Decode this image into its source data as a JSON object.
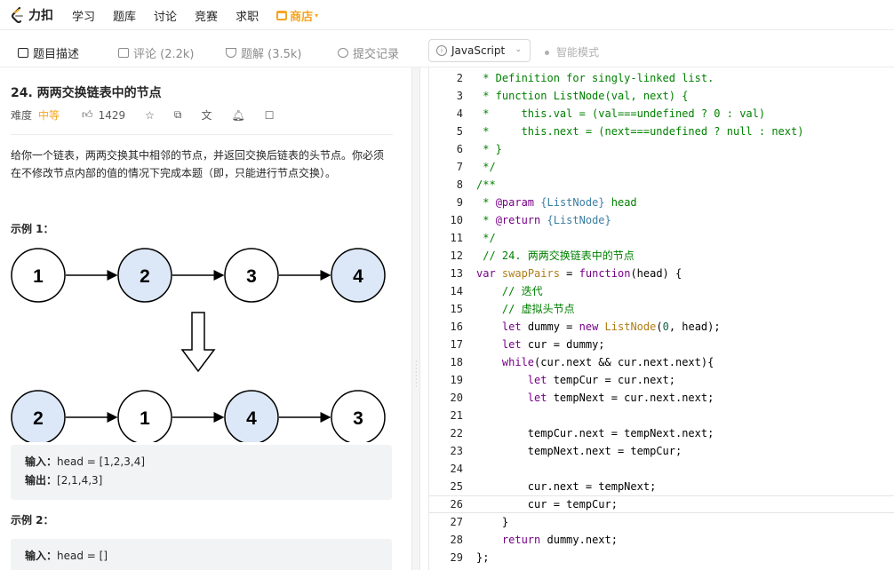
{
  "nav": {
    "logo_text": "力扣",
    "links": [
      "学习",
      "题库",
      "讨论",
      "竞赛",
      "求职"
    ],
    "shop_label": "商店"
  },
  "tabs": {
    "description": "题目描述",
    "comments": "评论 (2.2k)",
    "solutions": "题解 (3.5k)",
    "submissions": "提交记录"
  },
  "editor_toolbar": {
    "language": "JavaScript",
    "smart_mode": "智能模式"
  },
  "problem": {
    "title": "24. 两两交换链表中的节点",
    "difficulty_label": "难度",
    "difficulty": "中等",
    "likes": "1429",
    "description": "给你一个链表，两两交换其中相邻的节点，并返回交换后链表的头节点。你必须在不修改节点内部的值的情况下完成本题（即，只能进行节点交换）。",
    "example1_title": "示例 1：",
    "example1_input_label": "输入：",
    "example1_input": "head = [1,2,3,4]",
    "example1_output_label": "输出：",
    "example1_output": "[2,1,4,3]",
    "example2_title": "示例 2：",
    "example2_input_label": "输入：",
    "example2_input": "head = []",
    "diagram_top": [
      "1",
      "2",
      "3",
      "4"
    ],
    "diagram_bottom": [
      "2",
      "1",
      "4",
      "3"
    ]
  },
  "code": {
    "current_line": 26,
    "lines": [
      {
        "n": "2",
        "t": " * Definition for singly-linked list."
      },
      {
        "n": "3",
        "t": " * function ListNode(val, next) {"
      },
      {
        "n": "4",
        "t": " *     this.val = (val===undefined ? 0 : val)"
      },
      {
        "n": "5",
        "t": " *     this.next = (next===undefined ? null : next)"
      },
      {
        "n": "6",
        "t": " * }"
      },
      {
        "n": "7",
        "t": " */"
      },
      {
        "n": "8",
        "t": "/**"
      },
      {
        "n": "9",
        "t": " * @param {ListNode} head"
      },
      {
        "n": "10",
        "t": " * @return {ListNode}"
      },
      {
        "n": "11",
        "t": " */"
      },
      {
        "n": "12",
        "t": " // 24. 两两交换链表中的节点"
      },
      {
        "n": "13",
        "t": "var swapPairs = function(head) {"
      },
      {
        "n": "14",
        "t": "    // 迭代"
      },
      {
        "n": "15",
        "t": "    // 虚拟头节点"
      },
      {
        "n": "16",
        "t": "    let dummy = new ListNode(0, head);"
      },
      {
        "n": "17",
        "t": "    let cur = dummy;"
      },
      {
        "n": "18",
        "t": "    while(cur.next && cur.next.next){"
      },
      {
        "n": "19",
        "t": "        let tempCur = cur.next;"
      },
      {
        "n": "20",
        "t": "        let tempNext = cur.next.next;"
      },
      {
        "n": "21",
        "t": ""
      },
      {
        "n": "22",
        "t": "        tempCur.next = tempNext.next;"
      },
      {
        "n": "23",
        "t": "        tempNext.next = tempCur;"
      },
      {
        "n": "24",
        "t": ""
      },
      {
        "n": "25",
        "t": "        cur.next = tempNext;"
      },
      {
        "n": "26",
        "t": "        cur = tempCur;"
      },
      {
        "n": "27",
        "t": "    }"
      },
      {
        "n": "28",
        "t": "    return dummy.next;"
      },
      {
        "n": "29",
        "t": "};"
      }
    ]
  },
  "colors": {
    "accent_orange": "#f5a623",
    "node_highlight": "#dce8f7",
    "comment_green": "#008000",
    "keyword_purple": "#770088"
  }
}
